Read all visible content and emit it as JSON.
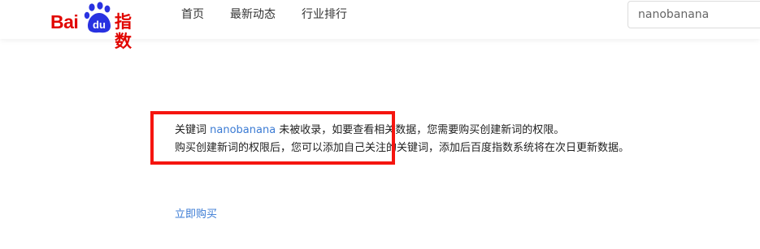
{
  "brand": {
    "logo_bai": "Bai",
    "logo_du": "du",
    "logo_zhishu": "指数"
  },
  "nav": {
    "items": [
      {
        "label": "首页"
      },
      {
        "label": "最新动态"
      },
      {
        "label": "行业排行"
      }
    ]
  },
  "search": {
    "value": "nanobanana"
  },
  "notice": {
    "line1_prefix": "关键词 ",
    "keyword": "nanobanana",
    "line1_suffix": " 未被收录，如要查看相关数据，您需要购买创建新词的权限。",
    "line2": "购买创建新词的权限后，您可以添加自己关注的关键词，添加后百度指数系统将在次日更新数据。"
  },
  "actions": {
    "buy_label": "立即购买"
  },
  "colors": {
    "brand_red": "#e10601",
    "brand_blue": "#2932e1",
    "link_blue": "#3b7bd4",
    "highlight_red": "#f5150f"
  }
}
